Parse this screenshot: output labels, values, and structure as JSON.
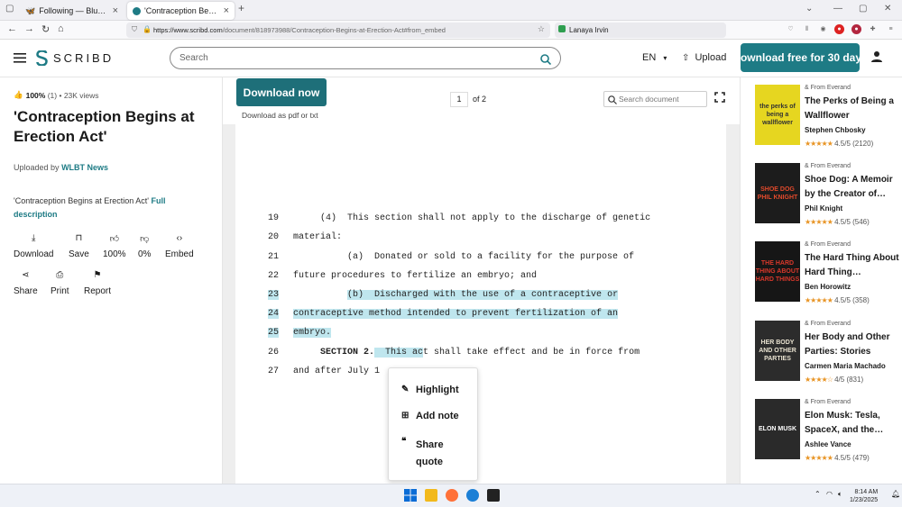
{
  "browser": {
    "tabs": [
      {
        "label": "Following — Bluesky",
        "active": false
      },
      {
        "label": "'Contraception Begins at Erection",
        "active": true
      }
    ],
    "url_domain": "https://www.scribd.com",
    "url_path": "/document/818973988/Contraception-Begins-at-Erection-Act#from_embed",
    "profile": "Lanaya Irvin"
  },
  "header": {
    "logo": "SCRIBD",
    "search_placeholder": "Search",
    "language": "EN",
    "upload": "Upload",
    "download_free": "Download free for 30 days"
  },
  "doc_info": {
    "rating": "100%",
    "rating_count": "(1)",
    "views": "23K views",
    "title": "'Contraception Begins at Erection Act'",
    "uploaded_by_label": "Uploaded by",
    "uploaded_by": "WLBT News",
    "description": "'Contraception Begins at Erection Act'",
    "full_description": "Full description",
    "actions": [
      "Download",
      "Save",
      "100%",
      "0%",
      "Embed",
      "Share",
      "Print",
      "Report"
    ]
  },
  "viewer": {
    "download_now": "Download now",
    "download_sub": "Download as pdf or txt",
    "page": "1",
    "of_pages": "of 2",
    "search_placeholder": "Search document",
    "lines": [
      {
        "n": "19",
        "t": "     (4)  This section shall not apply to the discharge of genetic"
      },
      {
        "n": "20",
        "t": "material:"
      },
      {
        "n": "21",
        "t": "          (a)  Donated or sold to a facility for the purpose of"
      },
      {
        "n": "22",
        "t": "future procedures to fertilize an embryo; and"
      },
      {
        "n": "23",
        "t_pre": "          ",
        "t_hl": "(b)  Discharged with the use of a contraceptive or"
      },
      {
        "n": "24",
        "t_hl": "contraceptive method intended to prevent fertilization of an"
      },
      {
        "n": "25",
        "t_hl": "embryo."
      },
      {
        "n": "26",
        "t_pre": "     ",
        "t_bold": "SECTION 2.",
        "t_hl": "  This ac",
        "t_post": "t shall take effect and be in force from"
      },
      {
        "n": "27",
        "t": "and after July 1"
      }
    ]
  },
  "popup": {
    "highlight": "Highlight",
    "add_note": "Add note",
    "share_quote_1": "Share",
    "share_quote_2": "quote"
  },
  "books": [
    {
      "from": "From Everand",
      "title": "The Perks of Being a Wallflower",
      "author": "Stephen Chbosky",
      "rating": "4.5/5 (2120)",
      "stars": "★★★★★",
      "cover_text": "the perks of being a wallflower",
      "cover_color": "#e6d620"
    },
    {
      "from": "From Everand",
      "title": "Shoe Dog: A Memoir by the Creator of…",
      "author": "Phil Knight",
      "rating": "4.5/5 (546)",
      "stars": "★★★★★",
      "cover_text": "SHOE DOG PHIL KNIGHT",
      "cover_color": "#1c1c1c"
    },
    {
      "from": "From Everand",
      "title": "The Hard Thing About Hard Thing…",
      "author": "Ben Horowitz",
      "rating": "4.5/5 (358)",
      "stars": "★★★★★",
      "cover_text": "THE HARD THING ABOUT HARD THINGS",
      "cover_color": "#161616"
    },
    {
      "from": "From Everand",
      "title": "Her Body and Other Parties: Stories",
      "author": "Carmen Maria Machado",
      "rating": "4/5 (831)",
      "stars": "★★★★☆",
      "cover_text": "HER BODY AND OTHER PARTIES",
      "cover_color": "#2c2c2c"
    },
    {
      "from": "From Everand",
      "title": "Elon Musk: Tesla, SpaceX, and the…",
      "author": "Ashlee Vance",
      "rating": "4.5/5 (479)",
      "stars": "★★★★★",
      "cover_text": "ELON MUSK",
      "cover_color": "#2a2a2a"
    }
  ],
  "taskbar": {
    "time": "8:14 AM",
    "date": "1/23/2025"
  },
  "colors": {
    "accent": "#1e7b85",
    "highlight": "#bfe6ee"
  }
}
